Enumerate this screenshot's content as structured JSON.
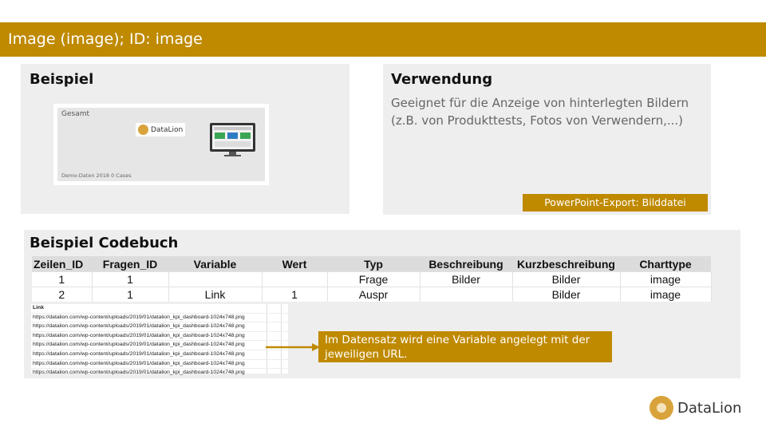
{
  "header": {
    "title": "Image (image); ID: image"
  },
  "beispiel": {
    "title": "Beispiel",
    "thumb_label": "Gesamt",
    "thumb_logo": "DataLion",
    "thumb_footer": "Demo-Daten 2018 0 Cases"
  },
  "verwendung": {
    "title": "Verwendung",
    "text": "Geeignet für die Anzeige von hinterlegten Bildern (z.B. von Produkttests, Fotos von Verwendern,...)",
    "export_badge": "PowerPoint-Export: Bilddatei"
  },
  "codebuch": {
    "title": "Beispiel Codebuch",
    "columns": [
      "Zeilen_ID",
      "Fragen_ID",
      "Variable",
      "Wert",
      "Typ",
      "Beschreibung",
      "Kurzbeschreibung",
      "Charttype"
    ],
    "rows": [
      [
        "1",
        "1",
        "",
        "",
        "Frage",
        "Bilder",
        "Bilder",
        "image"
      ],
      [
        "2",
        "1",
        "Link",
        "1",
        "Auspr",
        "",
        "Bilder",
        "image"
      ]
    ],
    "link_sheet": {
      "header": "Link",
      "urls": [
        "https://datalion.com/wp-content/uploads/2019/01/datalion_kpi_dashboard-1024x748.png",
        "https://datalion.com/wp-content/uploads/2019/01/datalion_kpi_dashboard-1024x748.png",
        "https://datalion.com/wp-content/uploads/2019/01/datalion_kpi_dashboard-1024x748.png",
        "https://datalion.com/wp-content/uploads/2019/01/datalion_kpi_dashboard-1024x748.png",
        "https://datalion.com/wp-content/uploads/2019/01/datalion_kpi_dashboard-1024x748.png",
        "https://datalion.com/wp-content/uploads/2019/01/datalion_kpi_dashboard-1024x748.png",
        "https://datalion.com/wp-content/uploads/2019/01/datalion_kpi_dashboard-1024x748.png"
      ]
    },
    "callout": "Im Datensatz wird eine Variable angelegt mit der jeweiligen URL."
  },
  "brand": {
    "name": "DataLion"
  },
  "colors": {
    "accent": "#bf8a00",
    "panel": "#eeeeee"
  }
}
